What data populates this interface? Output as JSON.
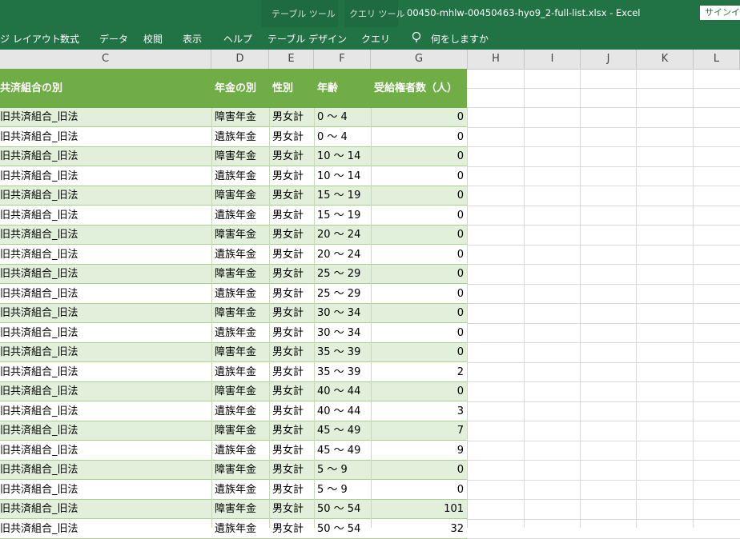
{
  "titlebar": {
    "ctx_table_tools": "テーブル ツール",
    "ctx_query_tools": "クエリ ツール",
    "doc_title": "00450-mhlw-00450463-hyo9_2-full-list.xlsx  -  Excel",
    "signin": "サインイン"
  },
  "ribbon": {
    "tabs": [
      "ジ レイアウト",
      "数式",
      "データ",
      "校閲",
      "表示",
      "ヘルプ",
      "テーブル デザイン",
      "クエリ"
    ],
    "tell_me": "何をしますか"
  },
  "columns": [
    "C",
    "D",
    "E",
    "F",
    "G",
    "H",
    "I",
    "J",
    "K",
    "L"
  ],
  "table": {
    "headers": [
      "共済組合の別",
      "年金の別",
      "性別",
      "年齢",
      "受給権者数（人）"
    ],
    "rows": [
      [
        "旧共済組合_旧法",
        "障害年金",
        "男女計",
        "0 ～ 4",
        "0"
      ],
      [
        "旧共済組合_旧法",
        "遺族年金",
        "男女計",
        "0 ～ 4",
        "0"
      ],
      [
        "旧共済組合_旧法",
        "障害年金",
        "男女計",
        "10 ～ 14",
        "0"
      ],
      [
        "旧共済組合_旧法",
        "遺族年金",
        "男女計",
        "10 ～ 14",
        "0"
      ],
      [
        "旧共済組合_旧法",
        "障害年金",
        "男女計",
        "15 ～ 19",
        "0"
      ],
      [
        "旧共済組合_旧法",
        "遺族年金",
        "男女計",
        "15 ～ 19",
        "0"
      ],
      [
        "旧共済組合_旧法",
        "障害年金",
        "男女計",
        "20 ～ 24",
        "0"
      ],
      [
        "旧共済組合_旧法",
        "遺族年金",
        "男女計",
        "20 ～ 24",
        "0"
      ],
      [
        "旧共済組合_旧法",
        "障害年金",
        "男女計",
        "25 ～ 29",
        "0"
      ],
      [
        "旧共済組合_旧法",
        "遺族年金",
        "男女計",
        "25 ～ 29",
        "0"
      ],
      [
        "旧共済組合_旧法",
        "障害年金",
        "男女計",
        "30 ～ 34",
        "0"
      ],
      [
        "旧共済組合_旧法",
        "遺族年金",
        "男女計",
        "30 ～ 34",
        "0"
      ],
      [
        "旧共済組合_旧法",
        "障害年金",
        "男女計",
        "35 ～ 39",
        "0"
      ],
      [
        "旧共済組合_旧法",
        "遺族年金",
        "男女計",
        "35 ～ 39",
        "2"
      ],
      [
        "旧共済組合_旧法",
        "障害年金",
        "男女計",
        "40 ～ 44",
        "0"
      ],
      [
        "旧共済組合_旧法",
        "遺族年金",
        "男女計",
        "40 ～ 44",
        "3"
      ],
      [
        "旧共済組合_旧法",
        "障害年金",
        "男女計",
        "45 ～ 49",
        "7"
      ],
      [
        "旧共済組合_旧法",
        "遺族年金",
        "男女計",
        "45 ～ 49",
        "9"
      ],
      [
        "旧共済組合_旧法",
        "障害年金",
        "男女計",
        "5 ～ 9",
        "0"
      ],
      [
        "旧共済組合_旧法",
        "遺族年金",
        "男女計",
        "5 ～ 9",
        "0"
      ],
      [
        "旧共済組合_旧法",
        "障害年金",
        "男女計",
        "50 ～ 54",
        "101"
      ],
      [
        "旧共済組合_旧法",
        "遺族年金",
        "男女計",
        "50 ～ 54",
        "32"
      ]
    ]
  },
  "colors": {
    "excel_green": "#217346",
    "table_header_green": "#70ad47",
    "band_green": "#e2efda"
  }
}
